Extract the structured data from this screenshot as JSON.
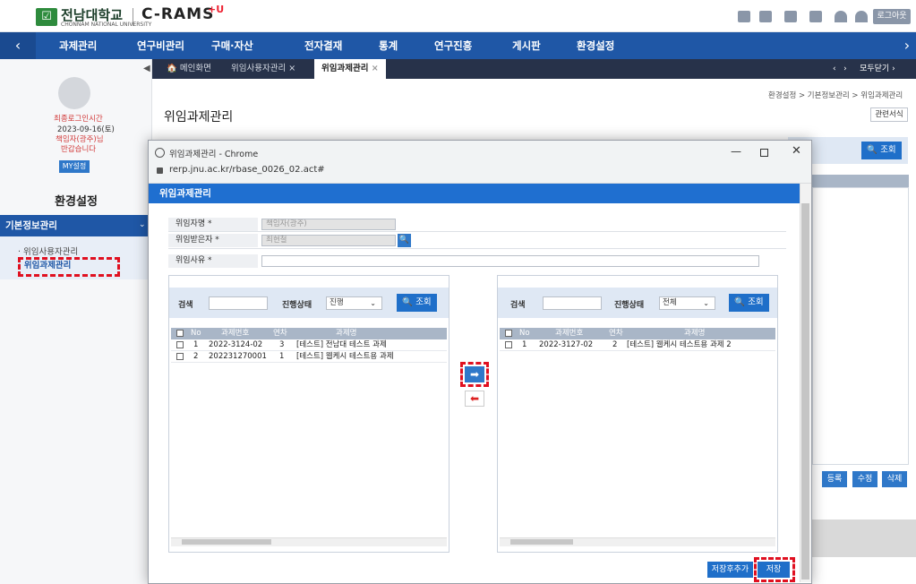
{
  "header": {
    "logo_mark": "☑",
    "university_name": "전남대학교",
    "university_sub": "CHONNAM NATIONAL UNIVERSITY",
    "app_name": "C-RAMS",
    "app_suffix": "+U",
    "logout_label": "로그아웃"
  },
  "nav": {
    "items": [
      "과제관리",
      "연구비관리",
      "구매·자산",
      "전자결재",
      "통계",
      "연구진흥",
      "게시판",
      "환경설정"
    ]
  },
  "sidebar": {
    "last_login_label": "최종로그인시간",
    "last_login_date": "2023-09-16(토)",
    "user_name": "책임자(광주)님",
    "greeting": "반갑습니다",
    "my_setting": "MY설정",
    "title": "환경설정",
    "group": "기본정보관리",
    "links": [
      "위임사용자관리",
      "위임과제관리"
    ]
  },
  "tabs": {
    "home": "메인화면",
    "items": [
      "위임사용자관리",
      "위임과제관리"
    ],
    "close_all": "모두닫기"
  },
  "main": {
    "breadcrumb": "환경설정 > 기본정보관리 > 위임과제관리",
    "title": "위임과제관리",
    "form_print": "관련서식",
    "search_btn": "조회",
    "actions": [
      "등록",
      "수정",
      "삭제"
    ]
  },
  "popup": {
    "window_title": "위임과제관리 - Chrome",
    "url": "rerp.jnu.ac.kr/rbase_0026_02.act#",
    "header": "위임과제관리",
    "fields": {
      "delegator_label": "위임자명 *",
      "delegator_value": "책임자(광주)",
      "delegatee_label": "위임받은자 *",
      "delegatee_value": "최현철",
      "reason_label": "위임사유 *",
      "reason_value": ""
    },
    "left_panel": {
      "search_label": "검색",
      "status_label": "진행상태",
      "status_value": "진행",
      "search_btn": "조회",
      "columns": [
        "No",
        "과제번호",
        "연차",
        "과제명"
      ],
      "rows": [
        {
          "no": "1",
          "code": "2022-3124-02",
          "year": "3",
          "name": "[테스트] 전남대 테스트 과제"
        },
        {
          "no": "2",
          "code": "202231270001",
          "year": "1",
          "name": "[테스트] 웹케시 테스트용 과제"
        }
      ]
    },
    "right_panel": {
      "search_label": "검색",
      "status_label": "진행상태",
      "status_value": "전체",
      "search_btn": "조회",
      "columns": [
        "No",
        "과제번호",
        "연차",
        "과제명"
      ],
      "rows": [
        {
          "no": "1",
          "code": "2022-3127-02",
          "year": "2",
          "name": "[테스트] 웹케시 테스트용 과제 2"
        }
      ]
    },
    "move_right": "➡",
    "move_left": "⬅",
    "save_add_label": "저장후추가",
    "save_label": "저장"
  }
}
